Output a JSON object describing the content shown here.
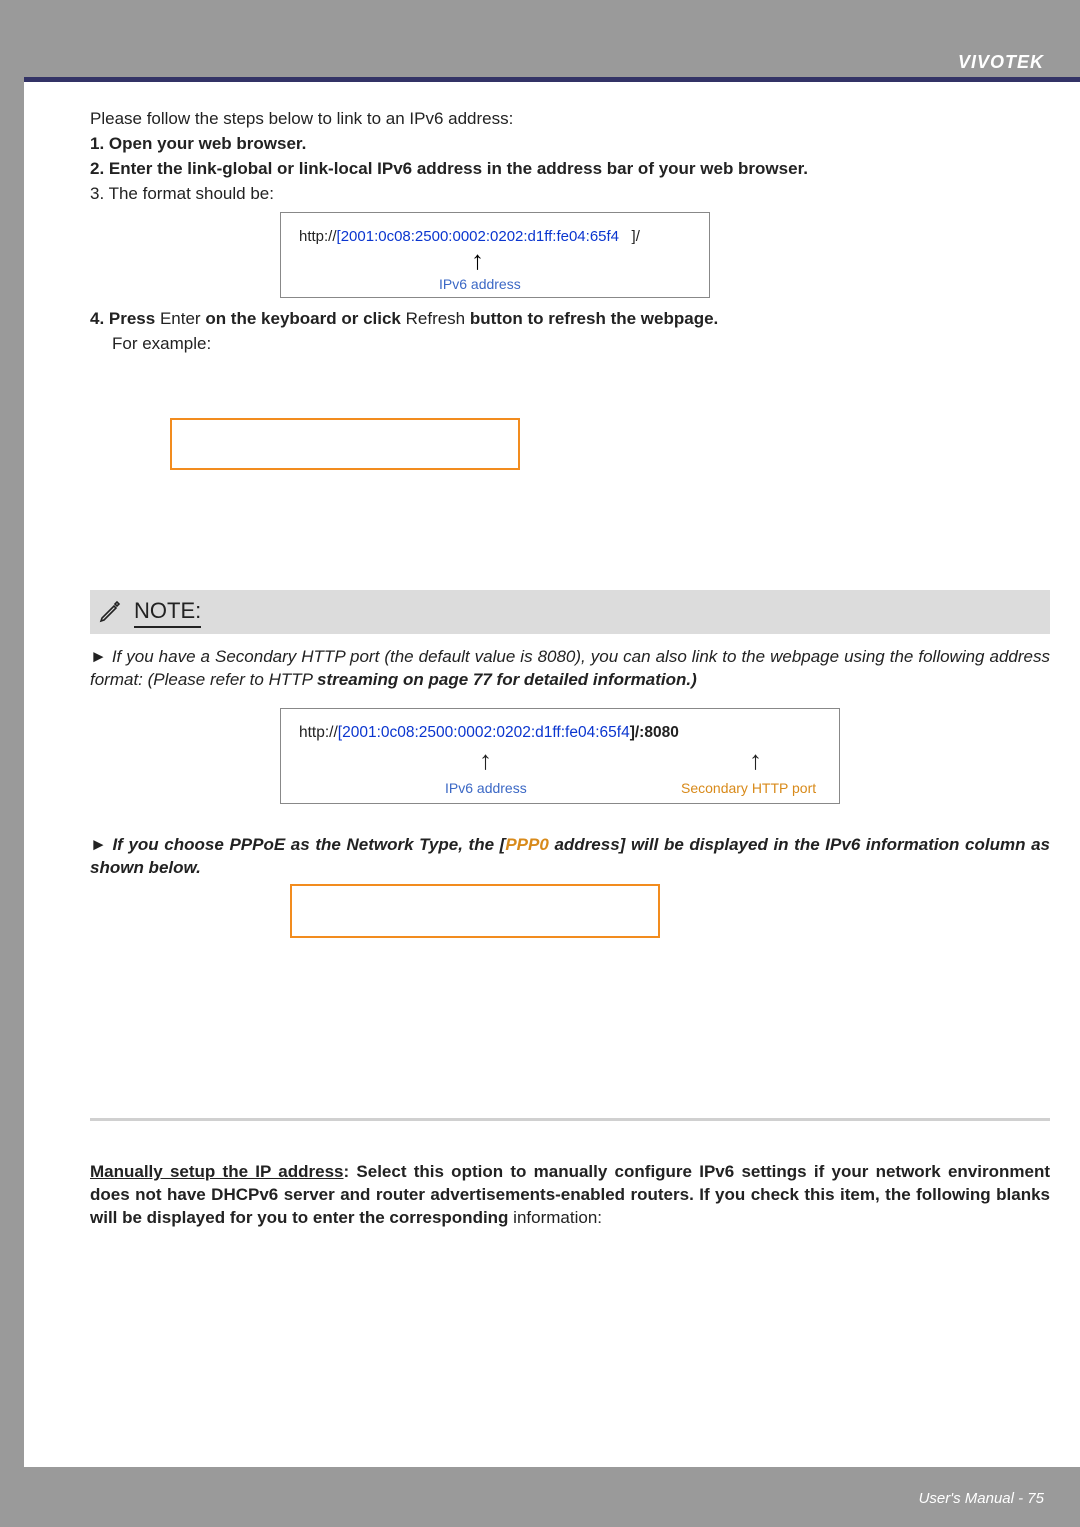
{
  "header": {
    "brand": "VIVOTEK"
  },
  "intro": {
    "lead": "Please follow the steps below to link to an IPv6 address:",
    "s1": "1. Open your web browser.",
    "s2": "2. Enter the link-global or link-local IPv6 address in the address bar of your web browser.",
    "s3": "3. The format should be:"
  },
  "box1": {
    "prefix": "http://",
    "open": "[",
    "ipv6": "2001:0c08:2500:0002:0202:d1ff:fe04:65f4",
    "close": "]",
    "suffix": "/",
    "caption": "IPv6 address"
  },
  "s4": {
    "a": "4. Press ",
    "b": "Enter",
    "c": " on the keyboard or click ",
    "d": "Refresh",
    "e": " button to refresh the webpage.",
    "eg": "For example:"
  },
  "note": {
    "label": "NOTE:",
    "para1_a": "► If you have a Secondary HTTP port (the default value is 8080), you can also link to the webpage using the following address format: (Please refer to HTTP ",
    "para1_b": "streaming on page 77 ",
    "para1_c": "for detailed information.)"
  },
  "box2": {
    "prefix": "http://",
    "open": "[",
    "ipv6": "2001:0c08:2500:0002:0202:d1ff:fe04:65f4",
    "close": "]",
    "suffix": "/:8080",
    "cap_a": "IPv6 address",
    "cap_b": "Secondary HTTP port"
  },
  "pppoe": {
    "a": "► If you choose PPPoE as the Network Type, the [",
    "b": "PPP0",
    "c": " address] will be displayed in the IPv6 information column as shown below."
  },
  "manual": {
    "title": "Manually setup the IP address",
    "body": ": Select this option to manually configure IPv6 settings if your network environment does not have DHCPv6 server and router advertisements-enabled routers. If you check this item, the following blanks will be displayed for you to enter the corresponding ",
    "tail": "information:"
  },
  "footer": {
    "text": "User's Manual - 75"
  }
}
